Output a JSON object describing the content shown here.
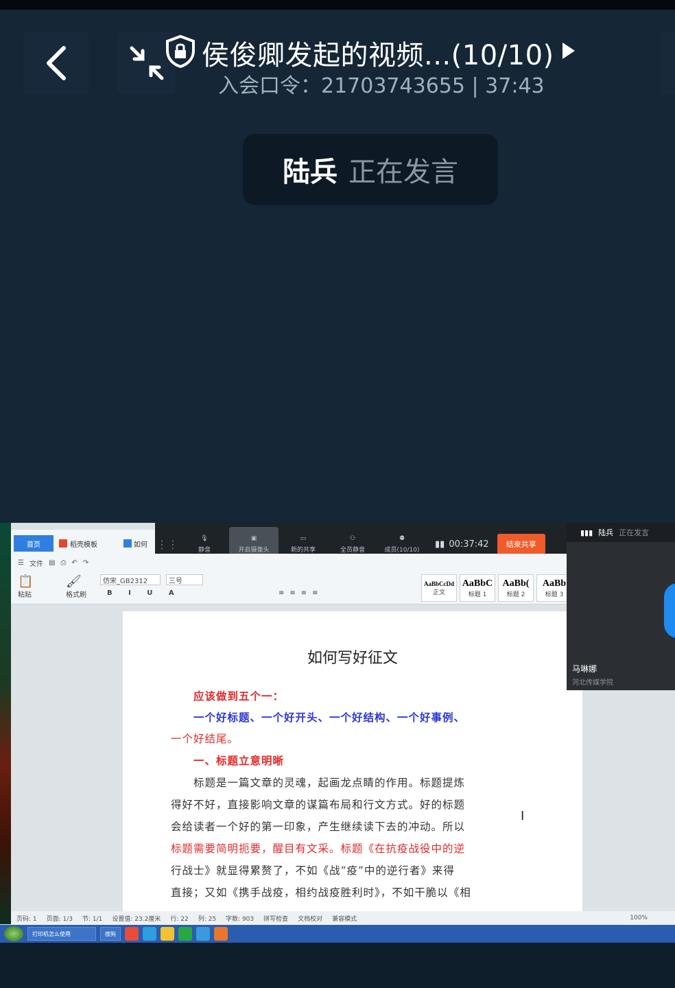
{
  "meeting": {
    "title": "侯俊卿发起的视频...(10/10)",
    "meeting_code_label": "入会口令：",
    "meeting_code": "21703743655",
    "elapsed": "37:43",
    "speaker_name": "陆兵",
    "speaker_status": "正在发言"
  },
  "wps": {
    "tab_home": "首页",
    "tab_doc": "稻壳模板",
    "tab_doc2": "如何",
    "menu_file": "文件",
    "font_name": "仿宋_GB2312",
    "font_size": "三号",
    "paste_label": "粘贴",
    "format_painter": "格式刷",
    "styles": [
      {
        "sample": "AaBbCcDd",
        "name": "正文"
      },
      {
        "sample": "AaBbC",
        "name": "标题 1"
      },
      {
        "sample": "AaBb(",
        "name": "标题 2"
      },
      {
        "sample": "AaBb",
        "name": "标题 3"
      }
    ]
  },
  "meeting_toolbar": {
    "mute": "静音",
    "camera": "开启摄像头",
    "new_share": "新的共享",
    "mute_all": "全员静音",
    "members": "成员(10/10)",
    "timer": "00:37:42",
    "end_share": "结束共享"
  },
  "document": {
    "title": "如何写好征文",
    "lines": [
      {
        "text": "应该做到五个一：",
        "color": "red"
      },
      {
        "text": "一个好标题、一个好开头、一个好结构、一个好事例、",
        "color": "blue"
      },
      {
        "text": "一个好结尾。",
        "color": "red"
      },
      {
        "text": "一、标题立意明晰",
        "color": "red"
      },
      {
        "text": "标题是一篇文章的灵魂，起画龙点睛的作用。标题提炼",
        "color": "dark"
      },
      {
        "text": "得好不好，直接影响文章的谋篇布局和行文方式。好的标题",
        "color": "dark"
      },
      {
        "text": "会给读者一个好的第一印象，产生继续读下去的冲动。所以",
        "color": "dark"
      },
      {
        "text": "标题需要简明扼要，醒目有文采。标题《在抗疫战役中的逆",
        "color": "dark"
      },
      {
        "text": "行战士》就显得累赘了，不如《战“疫”中的逆行者》来得",
        "color": "dark"
      },
      {
        "text": "直接；又如《携手战疫，相约战疫胜利时》，不如干脆以《相",
        "color": "dark"
      }
    ]
  },
  "status_bar": {
    "page_num": "页码: 1",
    "pages": "页面: 1/3",
    "section": "节: 1/1",
    "position": "设置值: 23.2厘米",
    "row": "行: 22",
    "col": "列: 25",
    "words": "字数: 903",
    "spellcheck": "拼写检查",
    "proof": "文档校对",
    "compat": "兼容模式",
    "zoom": "100%"
  },
  "taskbar": {
    "item1": "打印机怎么使用",
    "item2": "搜狗"
  },
  "side_panel": {
    "speaker": "陆兵",
    "speaker_status": "正在发言",
    "participant_name": "马琳娜",
    "participant_org": "河北传媒学院"
  },
  "colors": {
    "background": "#152636",
    "accent_blue": "#2f7fe0",
    "end_share": "#f05b2a"
  }
}
